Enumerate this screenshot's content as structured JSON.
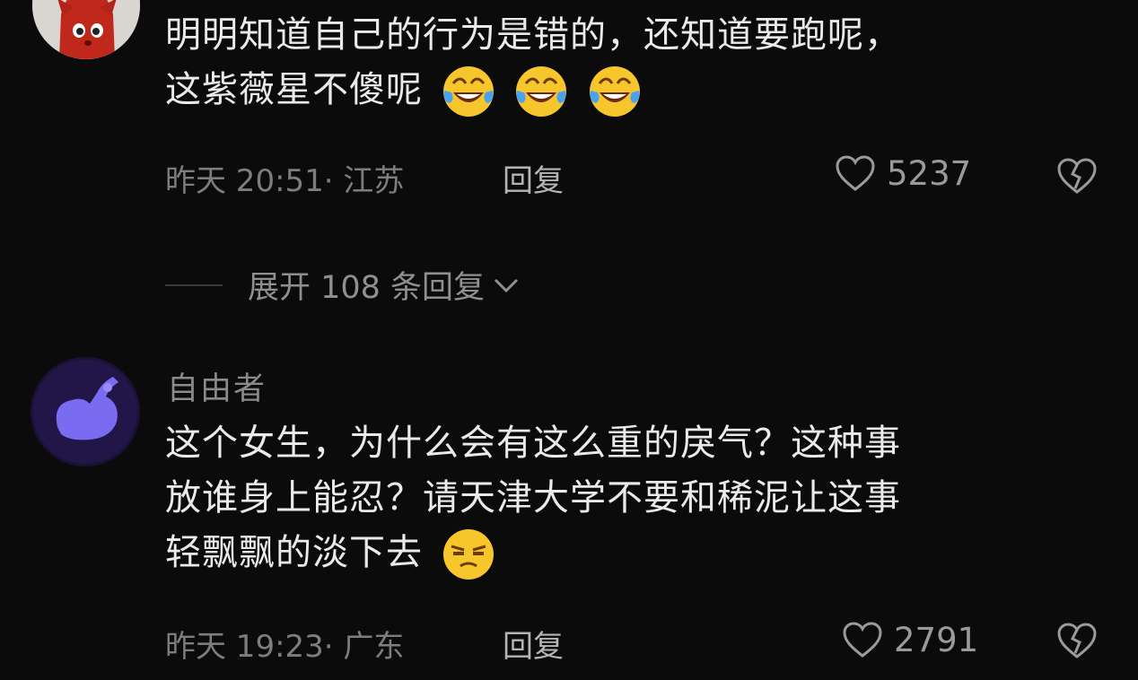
{
  "comments": [
    {
      "username": "",
      "text_line1": "明明知道自己的行为是错的，还知道要跑呢，",
      "text_line2": "这紫薇星不傻呢",
      "emoji_names": [
        "face-with-tears-of-joy-icon",
        "face-with-tears-of-joy-icon",
        "face-with-tears-of-joy-icon"
      ],
      "meta": "昨天 20:51· 江苏",
      "reply_label": "回复",
      "likes": "5237"
    },
    {
      "username": "自由者",
      "text_line1": "这个女生，为什么会有这么重的戾气？这种事",
      "text_line2": "放谁身上能忍？请天津大学不要和稀泥让这事",
      "text_line3": "轻飘飘的淡下去",
      "emoji_names": [
        "unamused-face-icon"
      ],
      "meta": "昨天 19:23· 广东",
      "reply_label": "回复",
      "likes": "2791"
    }
  ],
  "expand_replies_label": "展开 108 条回复",
  "colors": {
    "background": "#0b0b0c",
    "text_primary": "#eaeaea",
    "text_secondary": "#7d7d7d"
  }
}
